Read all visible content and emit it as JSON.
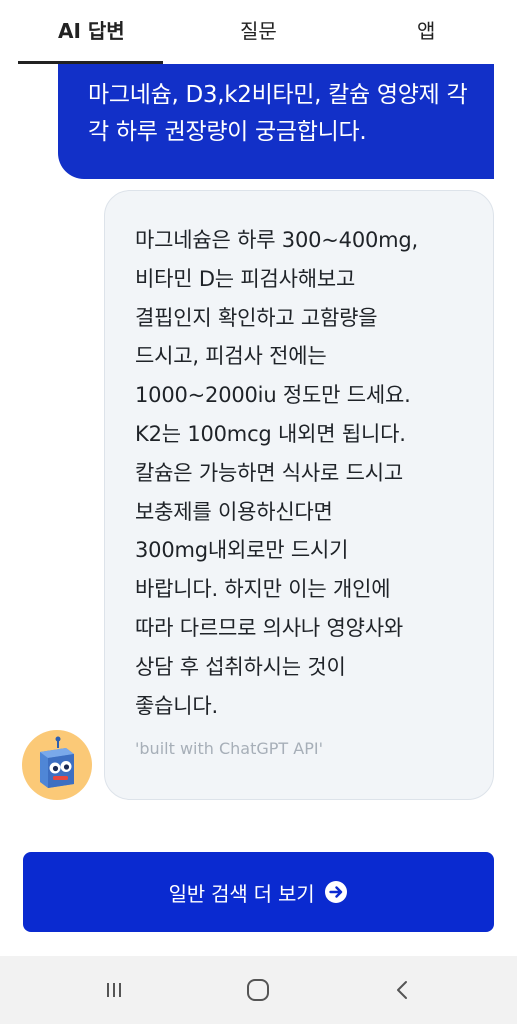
{
  "tabs": [
    {
      "label": "AI 답변",
      "active": true
    },
    {
      "label": "질문",
      "active": false
    },
    {
      "label": "앱",
      "active": false
    }
  ],
  "question": {
    "text": "마그네슘, D3,k2비타민, 칼슘 영양제 각각 하루 권장량이 궁금합니다."
  },
  "answer": {
    "text": "마그네슘은 하루 300~400mg,\n비타민 D는 피검사해보고\n결핍인지 확인하고 고함량을\n드시고, 피검사 전에는\n1000~2000iu 정도만 드세요.\nK2는 100mcg 내외면 됩니다.\n칼슘은 가능하면 식사로 드시고\n보충제를 이용하신다면\n300mg내외로만 드시기\n바랍니다. 하지만 이는 개인에\n따라 다르므로 의사나 영양사와\n상담 후 섭취하시는 것이\n좋습니다.",
    "built_with": "'built with ChatGPT API'"
  },
  "avatar": {
    "icon": "robot-mascot-icon"
  },
  "cta": {
    "label": "일반 검색 더 보기",
    "icon": "arrow-right-circle-icon"
  },
  "navbar": {
    "recent_icon": "recent-apps-icon",
    "home_icon": "home-icon",
    "back_icon": "back-icon"
  },
  "colors": {
    "primary": "#0a2ad0",
    "question_bubble": "#1230c8",
    "answer_bubble": "#f2f5f8",
    "avatar_bg": "#fbc977",
    "muted_text": "#a7afb8"
  }
}
